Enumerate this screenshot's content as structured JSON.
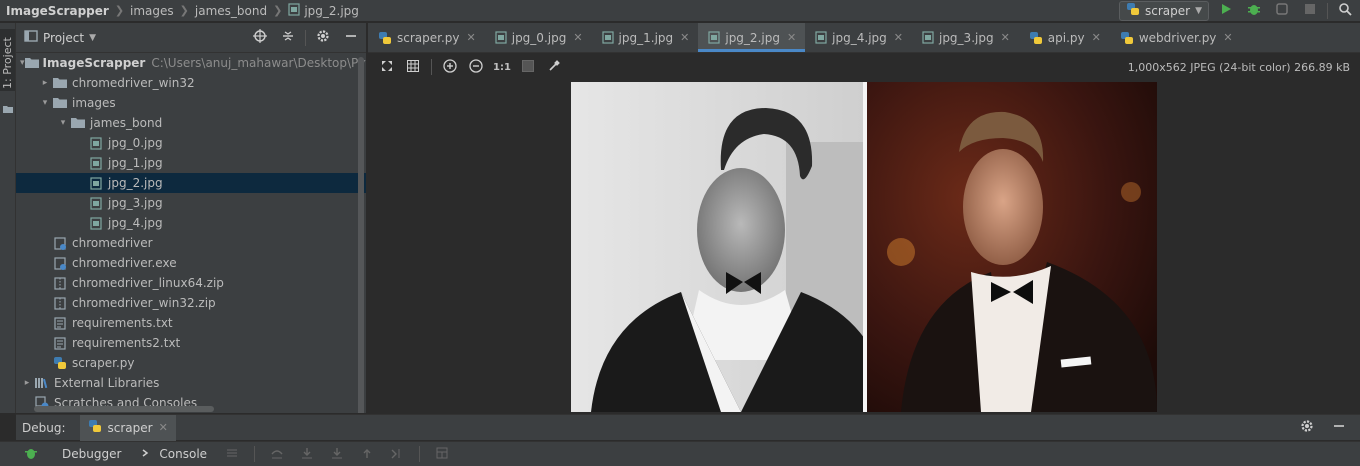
{
  "breadcrumb": [
    "ImageScrapper",
    "images",
    "james_bond",
    "jpg_2.jpg"
  ],
  "run_config": "scraper",
  "project_panel": {
    "title": "Project",
    "side_tab": "1: Project",
    "tree": [
      {
        "label": "ImageScrapper",
        "path": "C:\\Users\\anuj_mahawar\\Desktop\\Python",
        "type": "project",
        "level": 0,
        "expanded": true,
        "bold": true
      },
      {
        "label": "chromedriver_win32",
        "type": "folder",
        "level": 1,
        "expanded": false
      },
      {
        "label": "images",
        "type": "folder",
        "level": 1,
        "expanded": true
      },
      {
        "label": "james_bond",
        "type": "folder",
        "level": 2,
        "expanded": true
      },
      {
        "label": "jpg_0.jpg",
        "type": "image",
        "level": 3
      },
      {
        "label": "jpg_1.jpg",
        "type": "image",
        "level": 3
      },
      {
        "label": "jpg_2.jpg",
        "type": "image",
        "level": 3,
        "selected": true
      },
      {
        "label": "jpg_3.jpg",
        "type": "image",
        "level": 3
      },
      {
        "label": "jpg_4.jpg",
        "type": "image",
        "level": 3
      },
      {
        "label": "chromedriver",
        "type": "unknown",
        "level": 1
      },
      {
        "label": "chromedriver.exe",
        "type": "unknown",
        "level": 1
      },
      {
        "label": "chromedriver_linux64.zip",
        "type": "zip",
        "level": 1
      },
      {
        "label": "chromedriver_win32.zip",
        "type": "zip",
        "level": 1
      },
      {
        "label": "requirements.txt",
        "type": "text",
        "level": 1
      },
      {
        "label": "requirements2.txt",
        "type": "text",
        "level": 1
      },
      {
        "label": "scraper.py",
        "type": "python",
        "level": 1
      },
      {
        "label": "External Libraries",
        "type": "libraries",
        "level": 0,
        "expanded": false
      },
      {
        "label": "Scratches and Consoles",
        "type": "scratches",
        "level": 0
      }
    ]
  },
  "editor_tabs": [
    {
      "label": "scraper.py",
      "type": "python"
    },
    {
      "label": "jpg_0.jpg",
      "type": "image"
    },
    {
      "label": "jpg_1.jpg",
      "type": "image"
    },
    {
      "label": "jpg_2.jpg",
      "type": "image",
      "active": true
    },
    {
      "label": "jpg_4.jpg",
      "type": "image"
    },
    {
      "label": "jpg_3.jpg",
      "type": "image"
    },
    {
      "label": "api.py",
      "type": "python"
    },
    {
      "label": "webdriver.py",
      "type": "python"
    }
  ],
  "image_info": "1,000x562 JPEG (24-bit color) 266.89 kB",
  "image_toolbar": {
    "actual_size_label": "1:1"
  },
  "debug": {
    "label": "Debug:",
    "tab": "scraper",
    "debugger_label": "Debugger",
    "console_label": "Console"
  },
  "colors": {
    "accent": "#4a88c7",
    "selection": "#0d293e",
    "panel": "#3c3f41",
    "editor_bg": "#2b2b2b",
    "run_green": "#4caf50"
  }
}
